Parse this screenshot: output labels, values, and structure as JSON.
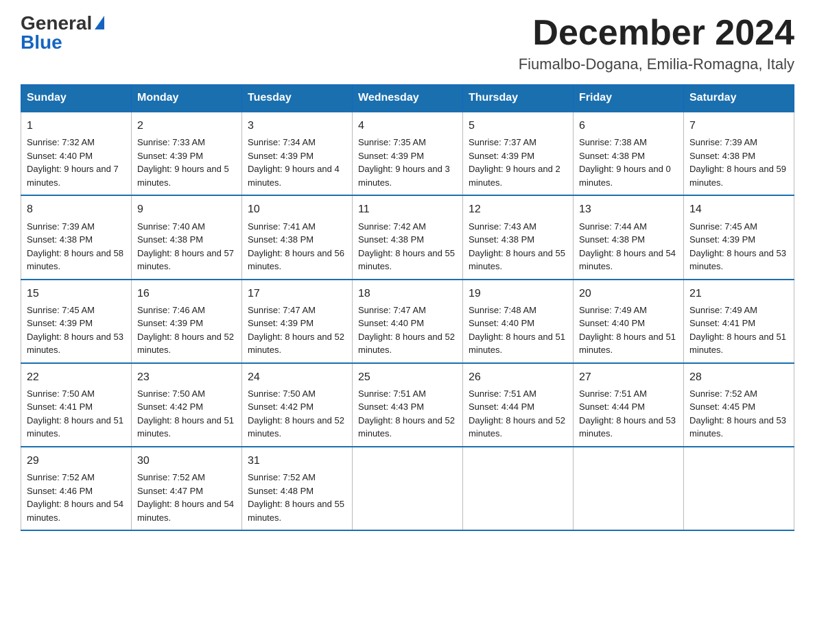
{
  "logo": {
    "general": "General",
    "blue": "Blue"
  },
  "header": {
    "month_year": "December 2024",
    "location": "Fiumalbo-Dogana, Emilia-Romagna, Italy"
  },
  "days_of_week": [
    "Sunday",
    "Monday",
    "Tuesday",
    "Wednesday",
    "Thursday",
    "Friday",
    "Saturday"
  ],
  "weeks": [
    [
      {
        "day": "1",
        "sunrise": "7:32 AM",
        "sunset": "4:40 PM",
        "daylight": "9 hours and 7 minutes."
      },
      {
        "day": "2",
        "sunrise": "7:33 AM",
        "sunset": "4:39 PM",
        "daylight": "9 hours and 5 minutes."
      },
      {
        "day": "3",
        "sunrise": "7:34 AM",
        "sunset": "4:39 PM",
        "daylight": "9 hours and 4 minutes."
      },
      {
        "day": "4",
        "sunrise": "7:35 AM",
        "sunset": "4:39 PM",
        "daylight": "9 hours and 3 minutes."
      },
      {
        "day": "5",
        "sunrise": "7:37 AM",
        "sunset": "4:39 PM",
        "daylight": "9 hours and 2 minutes."
      },
      {
        "day": "6",
        "sunrise": "7:38 AM",
        "sunset": "4:38 PM",
        "daylight": "9 hours and 0 minutes."
      },
      {
        "day": "7",
        "sunrise": "7:39 AM",
        "sunset": "4:38 PM",
        "daylight": "8 hours and 59 minutes."
      }
    ],
    [
      {
        "day": "8",
        "sunrise": "7:39 AM",
        "sunset": "4:38 PM",
        "daylight": "8 hours and 58 minutes."
      },
      {
        "day": "9",
        "sunrise": "7:40 AM",
        "sunset": "4:38 PM",
        "daylight": "8 hours and 57 minutes."
      },
      {
        "day": "10",
        "sunrise": "7:41 AM",
        "sunset": "4:38 PM",
        "daylight": "8 hours and 56 minutes."
      },
      {
        "day": "11",
        "sunrise": "7:42 AM",
        "sunset": "4:38 PM",
        "daylight": "8 hours and 55 minutes."
      },
      {
        "day": "12",
        "sunrise": "7:43 AM",
        "sunset": "4:38 PM",
        "daylight": "8 hours and 55 minutes."
      },
      {
        "day": "13",
        "sunrise": "7:44 AM",
        "sunset": "4:38 PM",
        "daylight": "8 hours and 54 minutes."
      },
      {
        "day": "14",
        "sunrise": "7:45 AM",
        "sunset": "4:39 PM",
        "daylight": "8 hours and 53 minutes."
      }
    ],
    [
      {
        "day": "15",
        "sunrise": "7:45 AM",
        "sunset": "4:39 PM",
        "daylight": "8 hours and 53 minutes."
      },
      {
        "day": "16",
        "sunrise": "7:46 AM",
        "sunset": "4:39 PM",
        "daylight": "8 hours and 52 minutes."
      },
      {
        "day": "17",
        "sunrise": "7:47 AM",
        "sunset": "4:39 PM",
        "daylight": "8 hours and 52 minutes."
      },
      {
        "day": "18",
        "sunrise": "7:47 AM",
        "sunset": "4:40 PM",
        "daylight": "8 hours and 52 minutes."
      },
      {
        "day": "19",
        "sunrise": "7:48 AM",
        "sunset": "4:40 PM",
        "daylight": "8 hours and 51 minutes."
      },
      {
        "day": "20",
        "sunrise": "7:49 AM",
        "sunset": "4:40 PM",
        "daylight": "8 hours and 51 minutes."
      },
      {
        "day": "21",
        "sunrise": "7:49 AM",
        "sunset": "4:41 PM",
        "daylight": "8 hours and 51 minutes."
      }
    ],
    [
      {
        "day": "22",
        "sunrise": "7:50 AM",
        "sunset": "4:41 PM",
        "daylight": "8 hours and 51 minutes."
      },
      {
        "day": "23",
        "sunrise": "7:50 AM",
        "sunset": "4:42 PM",
        "daylight": "8 hours and 51 minutes."
      },
      {
        "day": "24",
        "sunrise": "7:50 AM",
        "sunset": "4:42 PM",
        "daylight": "8 hours and 52 minutes."
      },
      {
        "day": "25",
        "sunrise": "7:51 AM",
        "sunset": "4:43 PM",
        "daylight": "8 hours and 52 minutes."
      },
      {
        "day": "26",
        "sunrise": "7:51 AM",
        "sunset": "4:44 PM",
        "daylight": "8 hours and 52 minutes."
      },
      {
        "day": "27",
        "sunrise": "7:51 AM",
        "sunset": "4:44 PM",
        "daylight": "8 hours and 53 minutes."
      },
      {
        "day": "28",
        "sunrise": "7:52 AM",
        "sunset": "4:45 PM",
        "daylight": "8 hours and 53 minutes."
      }
    ],
    [
      {
        "day": "29",
        "sunrise": "7:52 AM",
        "sunset": "4:46 PM",
        "daylight": "8 hours and 54 minutes."
      },
      {
        "day": "30",
        "sunrise": "7:52 AM",
        "sunset": "4:47 PM",
        "daylight": "8 hours and 54 minutes."
      },
      {
        "day": "31",
        "sunrise": "7:52 AM",
        "sunset": "4:48 PM",
        "daylight": "8 hours and 55 minutes."
      },
      null,
      null,
      null,
      null
    ]
  ]
}
